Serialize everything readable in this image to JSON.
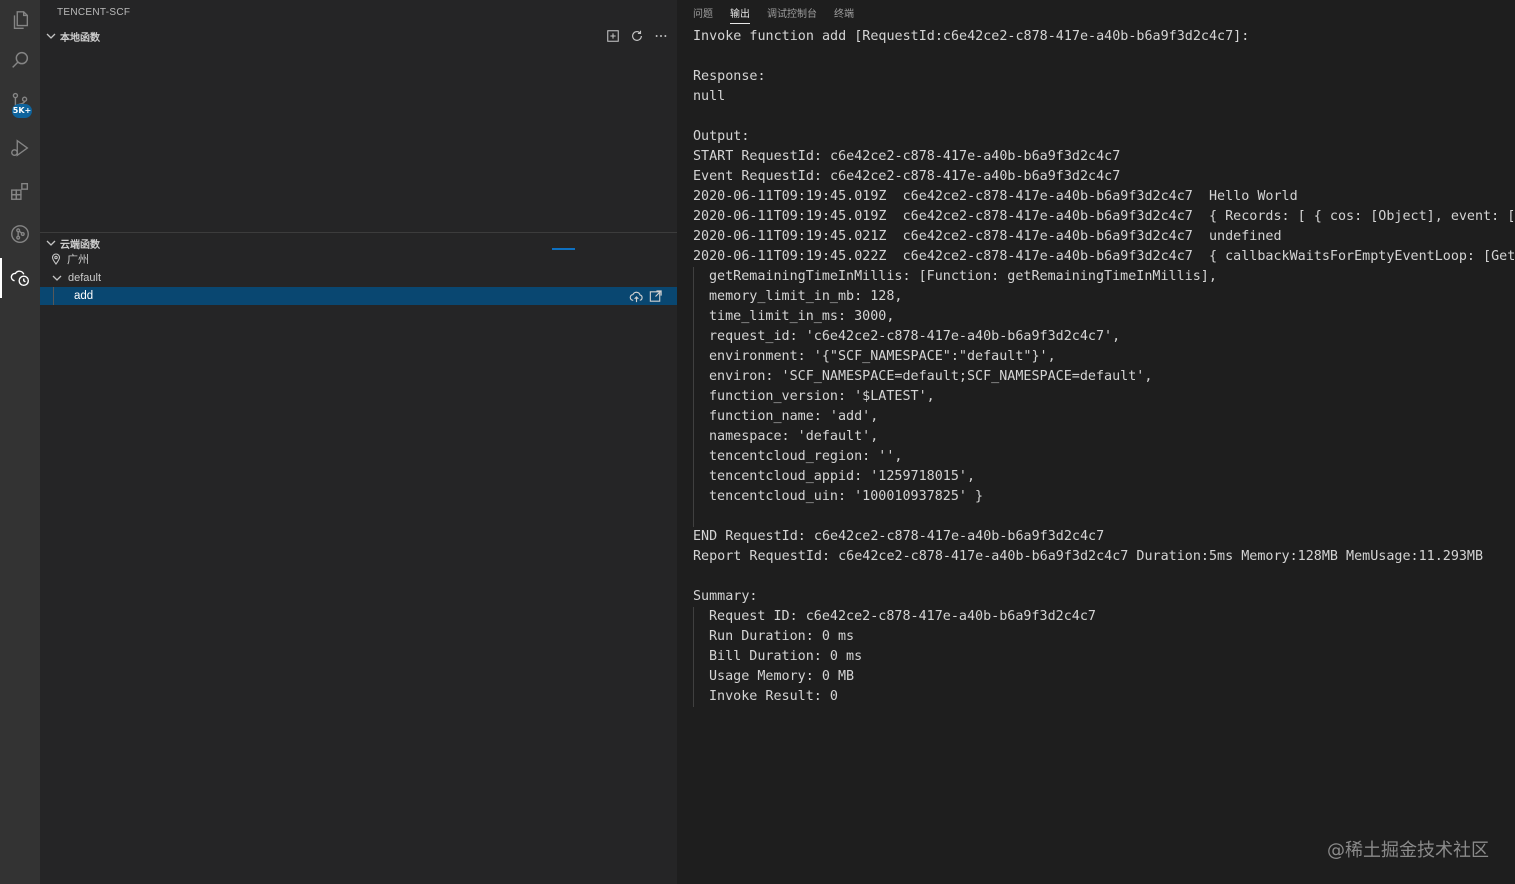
{
  "activity_bar": {
    "badge": "5K+"
  },
  "sidebar": {
    "title": "TENCENT-SCF",
    "local_section": {
      "label": "本地函数"
    },
    "cloud_section": {
      "label": "云端函数",
      "region": "广州",
      "namespace": "default",
      "function": "add"
    }
  },
  "panel": {
    "tabs": [
      {
        "label": "问题",
        "active": false
      },
      {
        "label": "输出",
        "active": true
      },
      {
        "label": "调试控制台",
        "active": false
      },
      {
        "label": "终端",
        "active": false
      }
    ],
    "output": {
      "header": "Invoke function add [RequestId:c6e42ce2-c878-417e-a40b-b6a9f3d2c4c7]:",
      "response_label": "Response:",
      "response_value": "null",
      "output_label": "Output:",
      "output_lines": [
        "START RequestId: c6e42ce2-c878-417e-a40b-b6a9f3d2c4c7",
        "Event RequestId: c6e42ce2-c878-417e-a40b-b6a9f3d2c4c7",
        "2020-06-11T09:19:45.019Z  c6e42ce2-c878-417e-a40b-b6a9f3d2c4c7  Hello World",
        "2020-06-11T09:19:45.019Z  c6e42ce2-c878-417e-a40b-b6a9f3d2c4c7  { Records: [ { cos: [Object], event: [Object] } ] }",
        "2020-06-11T09:19:45.021Z  c6e42ce2-c878-417e-a40b-b6a9f3d2c4c7  undefined",
        "2020-06-11T09:19:45.022Z  c6e42ce2-c878-417e-a40b-b6a9f3d2c4c7  { callbackWaitsForEmptyEventLoop: [Getter/Setter],"
      ],
      "context_lines": [
        "getRemainingTimeInMillis: [Function: getRemainingTimeInMillis],",
        "memory_limit_in_mb: 128,",
        "time_limit_in_ms: 3000,",
        "request_id: 'c6e42ce2-c878-417e-a40b-b6a9f3d2c4c7',",
        "environment: '{\"SCF_NAMESPACE\":\"default\"}',",
        "environ: 'SCF_NAMESPACE=default;SCF_NAMESPACE=default',",
        "function_version: '$LATEST',",
        "function_name: 'add',",
        "namespace: 'default',",
        "tencentcloud_region: '',",
        "tencentcloud_appid: '1259718015',",
        "tencentcloud_uin: '100010937825' }"
      ],
      "end_line": "END RequestId: c6e42ce2-c878-417e-a40b-b6a9f3d2c4c7",
      "report_line": "Report RequestId: c6e42ce2-c878-417e-a40b-b6a9f3d2c4c7 Duration:5ms Memory:128MB MemUsage:11.293MB",
      "summary_label": "Summary:",
      "summary_lines": [
        "Request ID: c6e42ce2-c878-417e-a40b-b6a9f3d2c4c7",
        "Run Duration: 0 ms",
        "Bill Duration: 0 ms",
        "Usage Memory: 0 MB",
        "Invoke Result: 0"
      ]
    }
  },
  "watermark": "@稀土掘金技术社区"
}
